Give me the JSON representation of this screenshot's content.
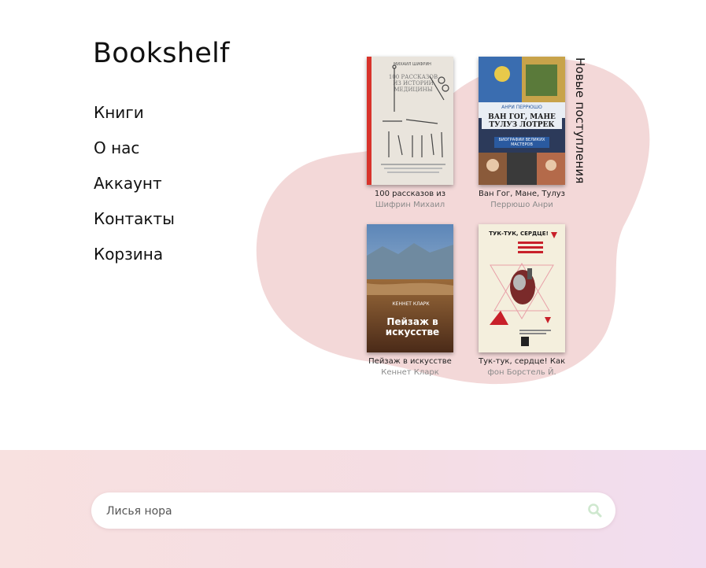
{
  "header": {
    "logo": "Bookshelf"
  },
  "nav": {
    "items": [
      {
        "label": "Книги"
      },
      {
        "label": "О нас"
      },
      {
        "label": "Аккаунт"
      },
      {
        "label": "Контакты"
      },
      {
        "label": "Корзина"
      }
    ]
  },
  "new_arrivals": {
    "heading": "Новые поступления",
    "books": [
      {
        "title": "100 рассказов из",
        "author": "Шифрин Михаил",
        "cover_author": "МИХАИЛ ШИФРИН",
        "cover_title": "100 РАССКАЗОВ ИЗ ИСТОРИИ МЕДИЦИНЫ"
      },
      {
        "title": "Ван Гог, Мане, Тулуз-",
        "author": "Перрюшо Анри",
        "cover_author": "АНРИ ПЕРРЮШО",
        "cover_title": "ВАН ГОГ, МАНЕ ТУЛУЗ ЛОТРЕК",
        "cover_series": "БИОГРАФИИ ВЕЛИКИХ МАСТЕРОВ"
      },
      {
        "title": "Пейзаж в искусстве",
        "author": "Кеннет Кларк",
        "cover_author": "КЕННЕТ КЛАРК",
        "cover_title": "Пейзаж в искусстве"
      },
      {
        "title": "Тук-тук, сердце! Как",
        "author": "фон Борстель Й.",
        "cover_title": "ТУК-ТУК, СЕРДЦЕ!"
      }
    ]
  },
  "search": {
    "value": "Лисья нора",
    "placeholder": ""
  },
  "colors": {
    "blob": "#f3d8d8",
    "footer_start": "#f8e1e0",
    "footer_end": "#f1ddf0",
    "search_icon": "#cfe8cf"
  }
}
